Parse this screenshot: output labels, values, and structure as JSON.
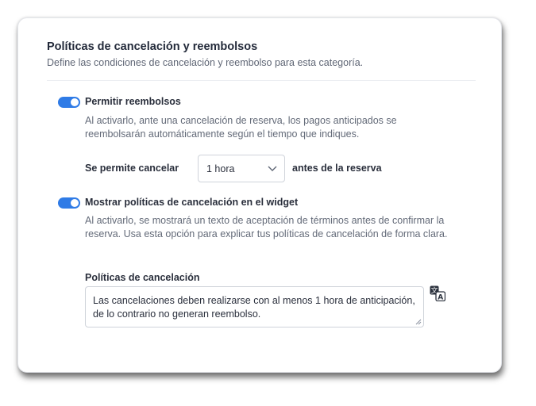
{
  "section": {
    "title": "Políticas de cancelación y reembolsos",
    "subtitle": "Define las condiciones de cancelación y reembolso para esta categoría."
  },
  "refunds": {
    "enabled": true,
    "label": "Permitir reembolsos",
    "description": "Al activarlo, ante una cancelación de reserva, los pagos anticipados se reembolsarán automáticamente según el tiempo que indiques.",
    "cancel_prefix": "Se permite cancelar",
    "cancel_selected": "1 hora",
    "cancel_suffix": "antes de la reserva"
  },
  "widget_policies": {
    "enabled": true,
    "label": "Mostrar políticas de cancelación en el widget",
    "description": "Al activarlo, se mostrará un texto de aceptación de términos antes de confirmar la reserva. Usa esta opción para explicar tus políticas de cancelación de forma clara.",
    "field_label": "Políticas de cancelación",
    "field_value": "Las cancelaciones deben realizarse con al menos 1 hora de anticipación, de lo contrario no generan reembolso."
  },
  "icons": {
    "translate": "translate-icon",
    "select_arrow": "chevron-down-icon",
    "resize": "resize-handle-icon"
  },
  "colors": {
    "accent": "#2f7be6"
  }
}
